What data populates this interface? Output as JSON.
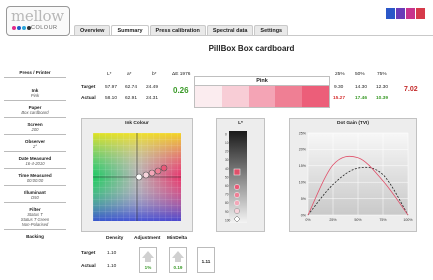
{
  "brand": {
    "name": "mellow",
    "sub": "COLOUR",
    "dot_colors": [
      "#e22b8a",
      "#1e5cc7",
      "#2aa5d9",
      "#333333"
    ]
  },
  "swatch_colors": [
    "#2b57c8",
    "#6a3bb8",
    "#c8338c",
    "#d63a4a"
  ],
  "tabs": [
    {
      "label": "Overview"
    },
    {
      "label": "Summary",
      "active": true
    },
    {
      "label": "Press calibration"
    },
    {
      "label": "Spectral data"
    },
    {
      "label": "Settings"
    }
  ],
  "title": "PillBox  Box cardboard",
  "sidebar": [
    {
      "heading": "Press / Printer",
      "value": ""
    },
    {
      "heading": "Ink",
      "value": "Pink"
    },
    {
      "heading": "Paper",
      "value": "Box cardboard"
    },
    {
      "heading": "Screen",
      "value": "200"
    },
    {
      "heading": "Observer",
      "value": "2°"
    },
    {
      "heading": "Date  Measured",
      "value": "16-4-2010"
    },
    {
      "heading": "Time Measured",
      "value": "00:00:00"
    },
    {
      "heading": "Illuminant",
      "value": "D50"
    },
    {
      "heading": "Filter",
      "value": "Status T"
    },
    {
      "heading": "",
      "value": "Status T Green"
    },
    {
      "heading": "",
      "value": "Non-Polarised"
    },
    {
      "heading": "Backing",
      "value": ""
    }
  ],
  "lab": {
    "headers": [
      "L*",
      "a*",
      "b*"
    ],
    "target_label": "Target",
    "actual_label": "Actual",
    "target": [
      "57.97",
      "62.74",
      "24.49"
    ],
    "actual": [
      "58.10",
      "62.91",
      "24.31"
    ],
    "de_label": "ΔE 1976",
    "de_value": "0.26"
  },
  "strip": {
    "title": "Pink",
    "colors": [
      "#fbecef",
      "#f8cdd6",
      "#f4a4b5",
      "#ef7f94",
      "#ec5e79"
    ]
  },
  "tvi": {
    "headers": [
      "25%",
      "50%",
      "75%"
    ],
    "target": [
      "9.30",
      "14.30",
      "12.30"
    ],
    "actual": [
      "15.27",
      "17.46",
      "10.39"
    ],
    "actual_colors": [
      "#d63434",
      "#3a9a28",
      "#3a9a28"
    ],
    "big_value": "7.02"
  },
  "ink_panel": {
    "title": "Ink Colour"
  },
  "l_panel": {
    "title": "L*",
    "ticks": [
      "0",
      "10",
      "20",
      "30",
      "40",
      "50",
      "60",
      "70",
      "80",
      "90",
      "100"
    ]
  },
  "dot_gain": {
    "title": "Dot Gain (TVI)",
    "y_ticks": [
      "25%",
      "20%",
      "15%",
      "10%",
      "5%",
      "0%"
    ],
    "x_ticks": [
      "0%",
      "25%",
      "50%",
      "75%",
      "100%"
    ]
  },
  "bottom": {
    "density_label": "Density",
    "adjustment_label": "Adjustment",
    "mindelta_label": "MinDelta",
    "target_label": "Target",
    "actual_label": "Actual",
    "target": "1.10",
    "actual": "1.10",
    "adjustment": "1%",
    "min_delta": "0.19",
    "third": "1.11"
  },
  "chart_data": {
    "type": "line",
    "title": "Dot Gain (TVI)",
    "x": [
      0,
      25,
      50,
      75,
      100
    ],
    "series": [
      {
        "values": [
          0,
          9.3,
          14.3,
          12.3,
          0
        ],
        "color": "#222222",
        "style": "dashed"
      },
      {
        "values": [
          0,
          15.27,
          17.46,
          10.39,
          0
        ],
        "color": "#e0506a",
        "style": "solid"
      }
    ],
    "xlim": [
      0,
      100
    ],
    "ylim": [
      0,
      25
    ],
    "grid": true
  }
}
